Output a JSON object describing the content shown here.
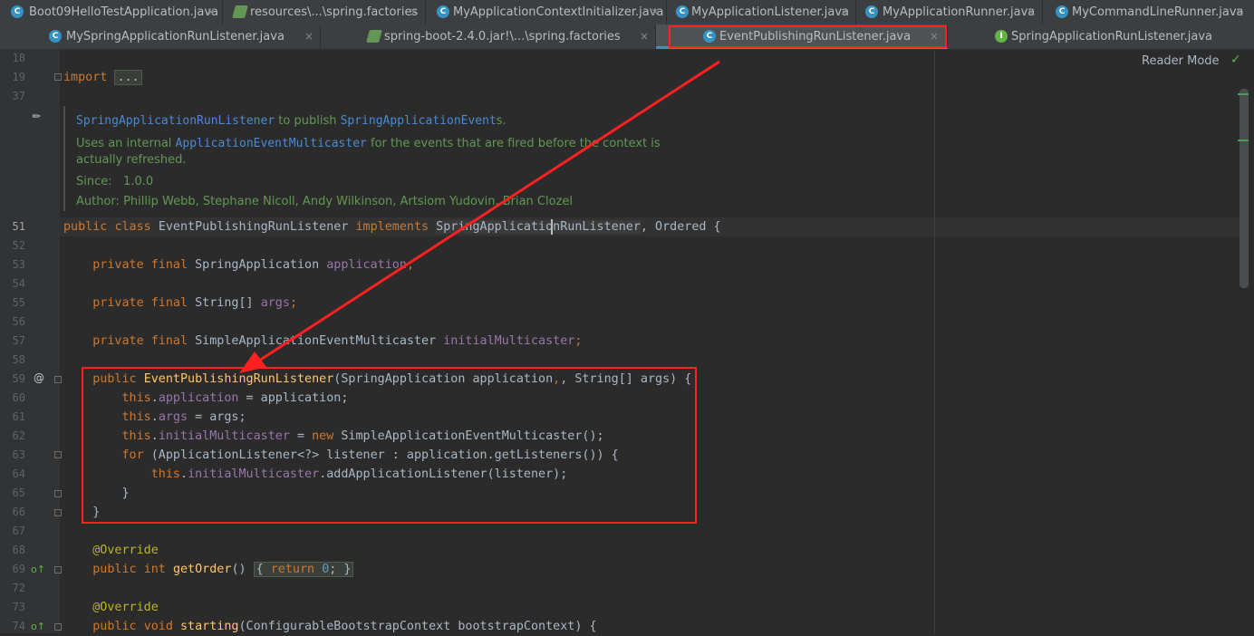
{
  "tabs_row1": [
    {
      "label": "Boot09HelloTestApplication.java",
      "icon": "spring-boot-class-icon"
    },
    {
      "label": "resources\\...\\spring.factories",
      "icon": "spring-factories-icon"
    },
    {
      "label": "MyApplicationContextInitializer.java",
      "icon": "class-icon"
    },
    {
      "label": "MyApplicationListener.java",
      "icon": "class-icon"
    },
    {
      "label": "MyApplicationRunner.java",
      "icon": "class-icon"
    },
    {
      "label": "MyCommandLineRunner.java",
      "icon": "class-icon"
    }
  ],
  "tabs_row2": [
    {
      "label": "MySpringApplicationRunListener.java",
      "icon": "class-icon"
    },
    {
      "label": "spring-boot-2.4.0.jar!\\...\\spring.factories",
      "icon": "spring-factories-icon"
    },
    {
      "label": "EventPublishingRunListener.java",
      "icon": "class-icon",
      "active": true
    },
    {
      "label": "SpringApplicationRunListener.java",
      "icon": "interface-icon"
    }
  ],
  "close_glyph": "×",
  "reader_mode": "Reader Mode",
  "line_numbers": [
    "18",
    "19",
    "37",
    "51",
    "52",
    "53",
    "54",
    "55",
    "56",
    "57",
    "58",
    "59",
    "60",
    "61",
    "62",
    "63",
    "64",
    "65",
    "66",
    "67",
    "68",
    "69",
    "72",
    "73",
    "74"
  ],
  "javadoc": {
    "line1_a": "SpringApplicationRunListener",
    "line1_b": " to publish ",
    "line1_c": "SpringApplicationEvent",
    "line1_d": "s.",
    "line2_a": "Uses an internal ",
    "line2_b": "ApplicationEventMulticaster",
    "line2_c": " for the events that are fired before the context is",
    "line3": "actually refreshed.",
    "since_label": "Since:",
    "since_value": "1.0.0",
    "author_label": "Author:",
    "author_value": "Phillip Webb, Stephane Nicoll, Andy Wilkinson, Artsiom Yudovin, Brian Clozel"
  },
  "code": {
    "import_kw": "import",
    "import_fold": "...",
    "public": "public",
    "class": "class",
    "classname": "EventPublishingRunListener",
    "implements": "implements",
    "iface": "SpringApplicationRunListener",
    "ordered": ", Ordered {",
    "private": "private",
    "final": "final",
    "t_springapp": "SpringApplication",
    "f_application": "application",
    "t_string": "String[]",
    "f_args": "args",
    "t_multicaster": "SimpleApplicationEventMulticaster",
    "f_multicaster": "initialMulticaster",
    "semi": ";",
    "ctor_name": "EventPublishingRunListener",
    "ctor_params_a": "(SpringApplication application",
    "ctor_params_b": ", String[] args) {",
    "this": "this",
    "dot": ".",
    "assign_application": " = application;",
    "assign_args": " = args;",
    "assign_new_eq": " = ",
    "new": "new",
    "new_rest": " SimpleApplicationEventMulticaster();",
    "for": "for",
    "for_rest": " (ApplicationListener<?> listener : application.getListeners()) {",
    "add_listener": ".addApplicationListener(listener);",
    "close_brace": "}",
    "override": "@Override",
    "int": "int",
    "get_order": "getOrder",
    "paren": "()",
    "fold_open": "{ ",
    "return": "return",
    "zero": "0",
    "fold_close": "; }",
    "void": "void",
    "starting": "starting",
    "starting_params": "(ConfigurableBootstrapContext bootstrapContext) {"
  }
}
